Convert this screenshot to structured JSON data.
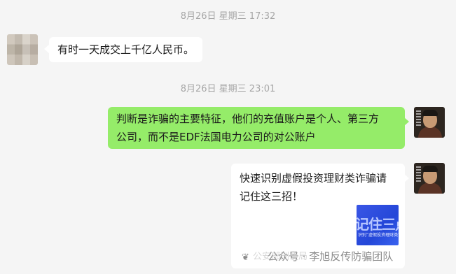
{
  "timestamps": [
    "8月26日 星期三 17:32",
    "8月26日 星期三 23:01"
  ],
  "messages": [
    {
      "side": "incoming",
      "text": "有时一天成交上千亿人民币。"
    },
    {
      "side": "outgoing",
      "line1": "判断是诈骗的主要特征，他们的充值账户是个人、第三方",
      "line2": "公司，而不是EDF法国电力公司的对公账户"
    },
    {
      "side": "outgoing",
      "title1": "快速识别虚假投资理财类诈骗请",
      "title2": "记住这三招！",
      "thumb_big": "记住三点",
      "thumb_small": "识别“虚假投资理财类”诈骗"
    }
  ],
  "watermark": {
    "text": "公众号 · 李旭反传防骗团队",
    "prefix_faded": "公安部刑侦局"
  },
  "icons": {
    "watermark_icon": "wechat-official-account-icon"
  },
  "colors": {
    "background": "#f5f5f5",
    "outgoing_bubble": "#95ec69",
    "incoming_bubble": "#ffffff",
    "timestamp": "#a6a6a6"
  }
}
